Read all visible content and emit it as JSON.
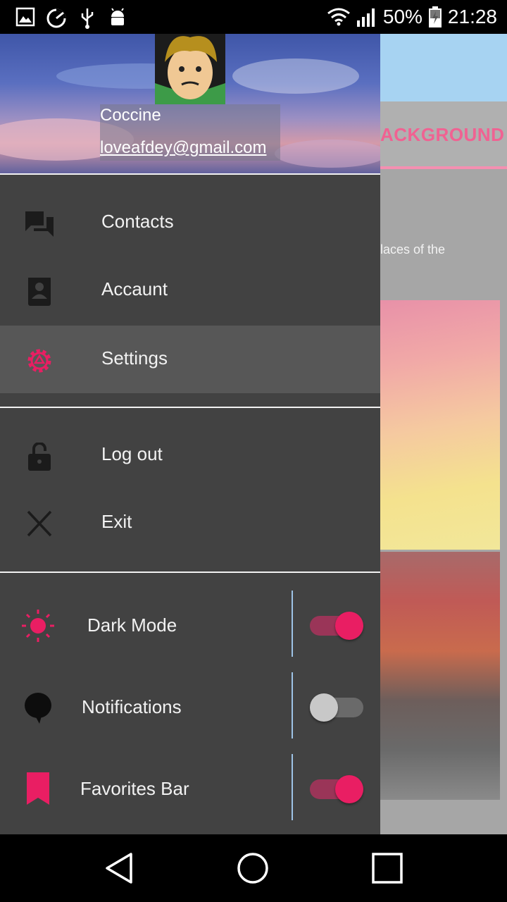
{
  "status_bar": {
    "battery": "50%",
    "time": "21:28",
    "left_icons": [
      "gallery-icon",
      "sync-icon",
      "usb-icon",
      "android-debug-icon"
    ],
    "right_icons": [
      "wifi-icon",
      "signal-icon",
      "battery-charging-icon"
    ]
  },
  "background_app": {
    "tab_label": "ACKGROUND",
    "text_fragment": "laces of the"
  },
  "drawer": {
    "user": {
      "name": "Coccine",
      "email": "loveafdey@gmail.com"
    },
    "menu": [
      {
        "label": "Contacts",
        "icon": "chat-bubbles-icon",
        "active": false
      },
      {
        "label": "Accaunt",
        "icon": "contact-card-icon",
        "active": false
      },
      {
        "label": "Settings",
        "icon": "gear-icon",
        "active": true
      }
    ],
    "secondary_menu": [
      {
        "label": "Log out",
        "icon": "lock-open-icon"
      },
      {
        "label": "Exit",
        "icon": "close-icon"
      }
    ],
    "toggles": [
      {
        "label": "Dark Mode",
        "icon": "sun-icon",
        "on": true
      },
      {
        "label": "Notifications",
        "icon": "speech-bubble-icon",
        "on": false
      },
      {
        "label": "Favorites Bar",
        "icon": "bookmark-icon",
        "on": true
      }
    ]
  },
  "colors": {
    "accent": "#e91e63",
    "drawer_bg": "#424242",
    "active_item_bg": "#575757"
  },
  "nav_bar": {
    "icons": [
      "back-icon",
      "home-icon",
      "recents-icon"
    ]
  }
}
